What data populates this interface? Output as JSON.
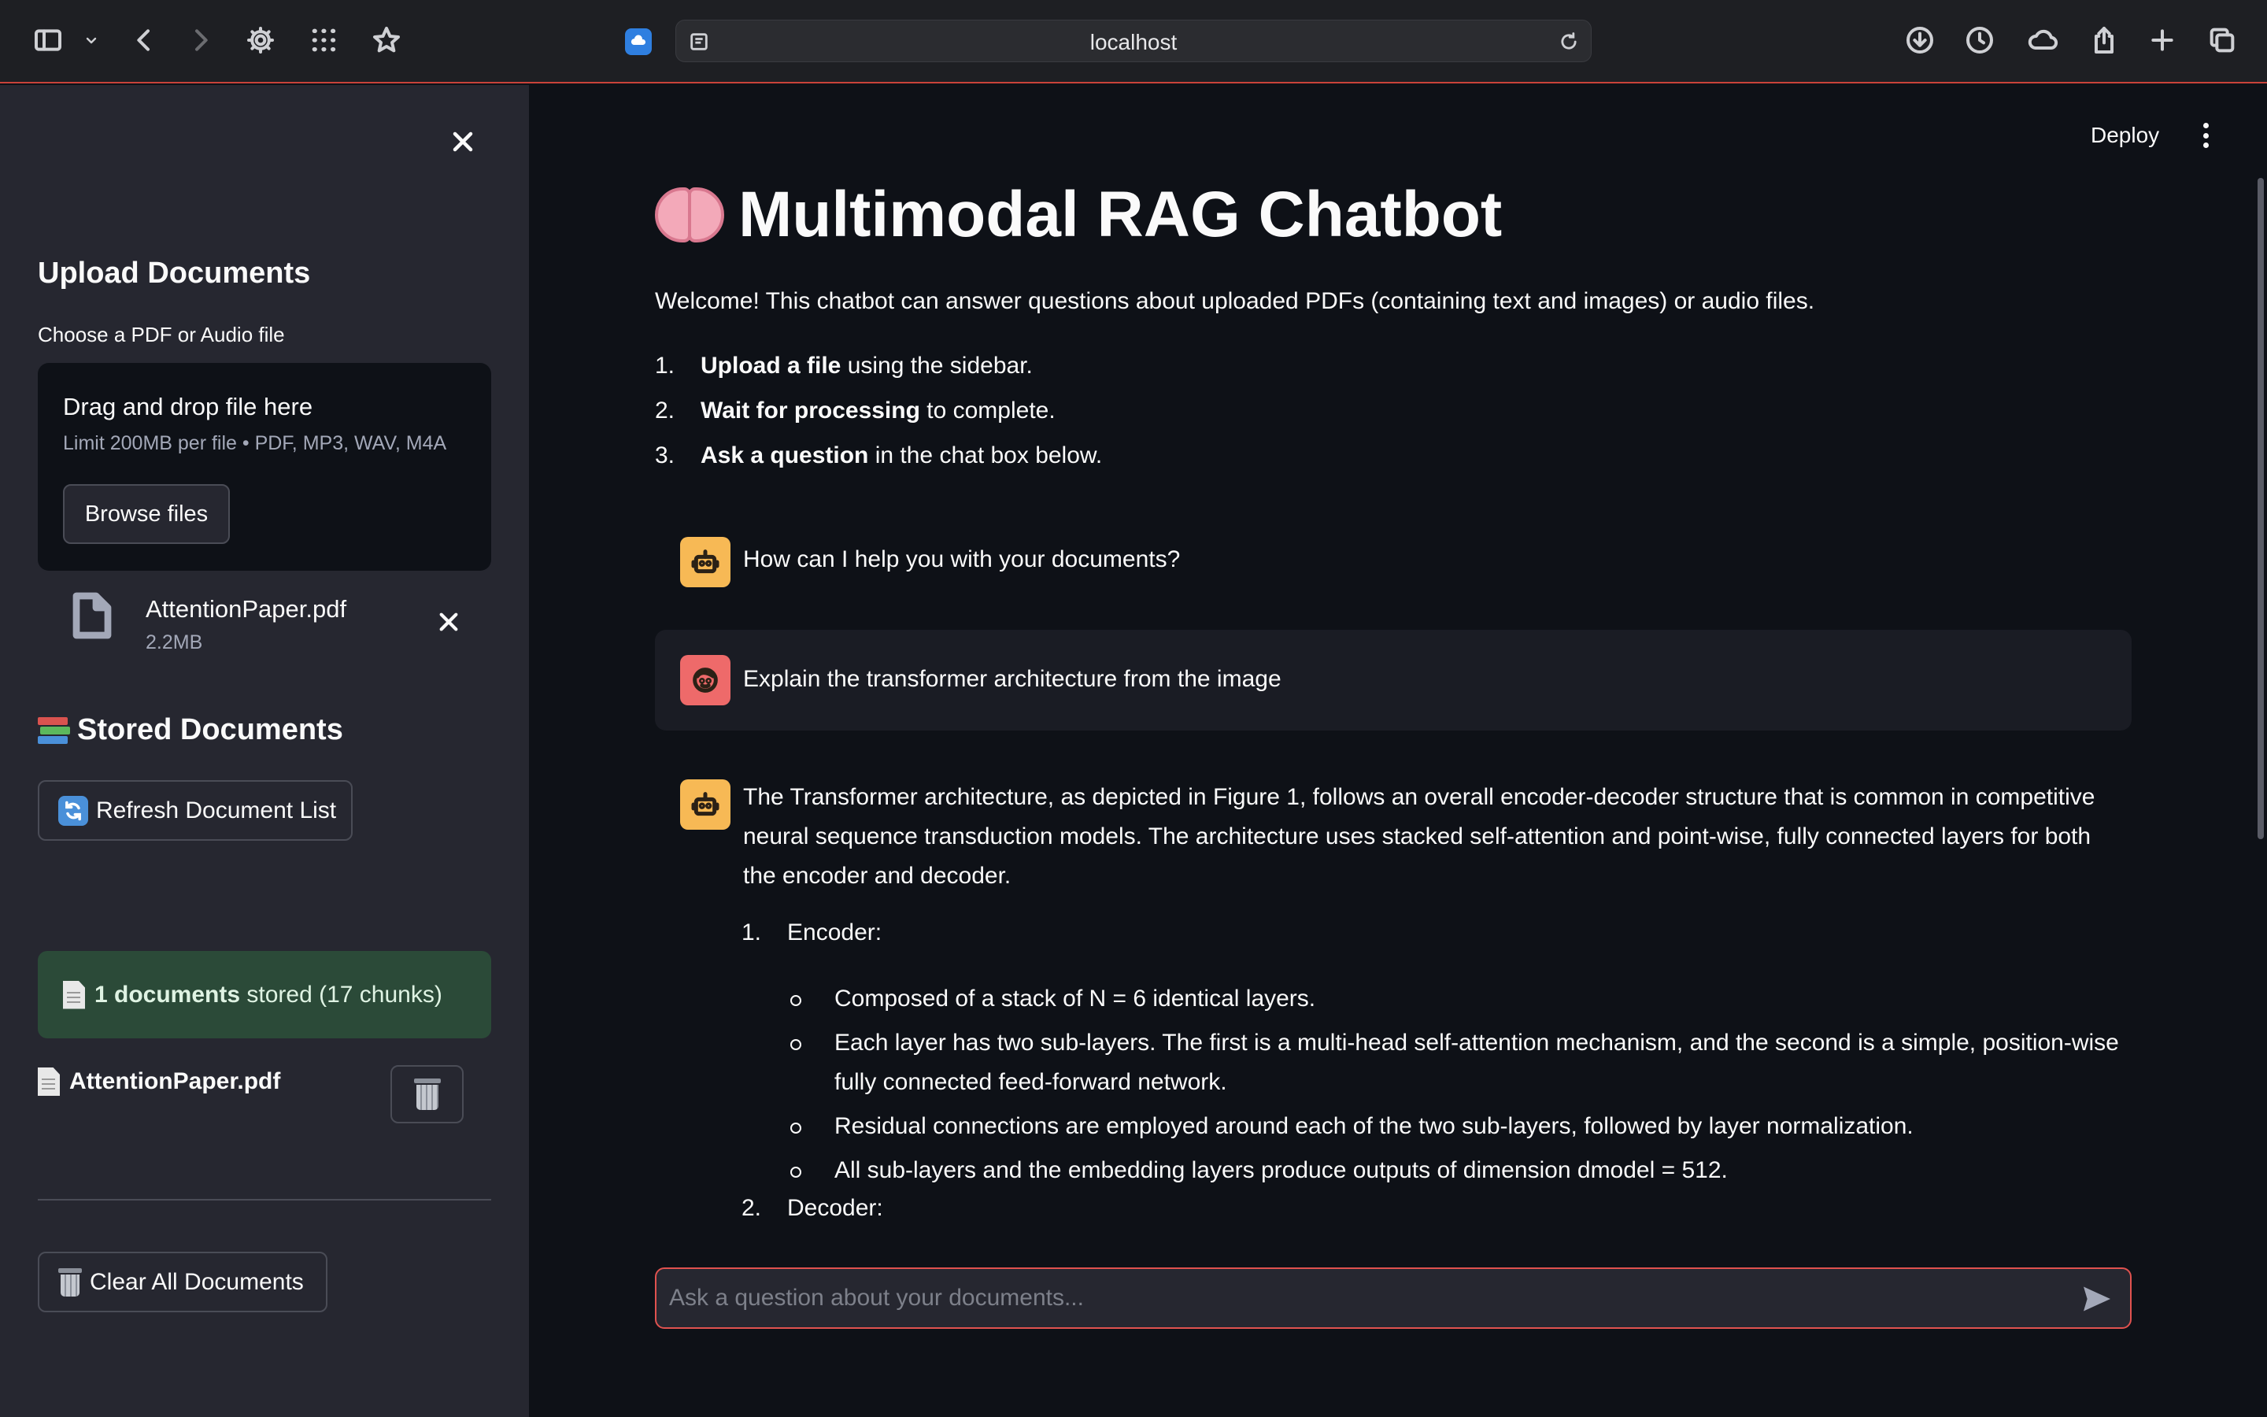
{
  "browser": {
    "url": "localhost"
  },
  "sidebar": {
    "upload_heading": "Upload Documents",
    "file_label": "Choose a PDF or Audio file",
    "dropzone": {
      "title": "Drag and drop file here",
      "limit": "Limit 200MB per file • PDF, MP3, WAV, M4A",
      "browse_label": "Browse files"
    },
    "uploaded_file": {
      "name": "AttentionPaper.pdf",
      "size": "2.2MB"
    },
    "stored_heading": "Stored Documents",
    "refresh_label": "Refresh Document List",
    "status": {
      "count_bold": "1 documents",
      "rest": " stored (17 chunks)",
      "color": "#2b4a38"
    },
    "stored_docs": [
      {
        "name": "AttentionPaper.pdf"
      }
    ],
    "clear_label": "Clear All Documents"
  },
  "header": {
    "deploy_label": "Deploy"
  },
  "main": {
    "title": "Multimodal RAG Chatbot",
    "welcome": "Welcome! This chatbot can answer questions about uploaded PDFs (containing text and images) or audio files.",
    "steps": [
      {
        "num": "1.",
        "bold": "Upload a file",
        "rest": " using the sidebar."
      },
      {
        "num": "2.",
        "bold": "Wait for processing",
        "rest": " to complete."
      },
      {
        "num": "3.",
        "bold": "Ask a question",
        "rest": " in the chat box below."
      }
    ]
  },
  "chat": {
    "greeting": "How can I help you with your documents?",
    "user_question": "Explain the transformer architecture from the image",
    "answer_intro": "The Transformer architecture, as depicted in Figure 1, follows an overall encoder-decoder structure that is common in competitive neural sequence transduction models. The architecture uses stacked self-attention and point-wise, fully connected layers for both the encoder and decoder.",
    "sections": [
      {
        "num": "1.",
        "title": "Encoder:",
        "bullets": [
          "Composed of a stack of N = 6 identical layers.",
          "Each layer has two sub-layers. The first is a multi-head self-attention mechanism, and the second is a simple, position-wise fully connected feed-forward network.",
          "Residual connections are employed around each of the two sub-layers, followed by layer normalization.",
          "All sub-layers and the embedding layers produce outputs of dimension dmodel = 512."
        ]
      },
      {
        "num": "2.",
        "title": "Decoder:"
      }
    ],
    "input_placeholder": "Ask a question about your documents...",
    "accent_color": "#e0524f",
    "bot_avatar_color": "#f7b955",
    "user_avatar_color": "#ee6a6a"
  },
  "icons": {
    "bot": "robot-icon",
    "user": "face-icon",
    "send": "send-icon"
  }
}
